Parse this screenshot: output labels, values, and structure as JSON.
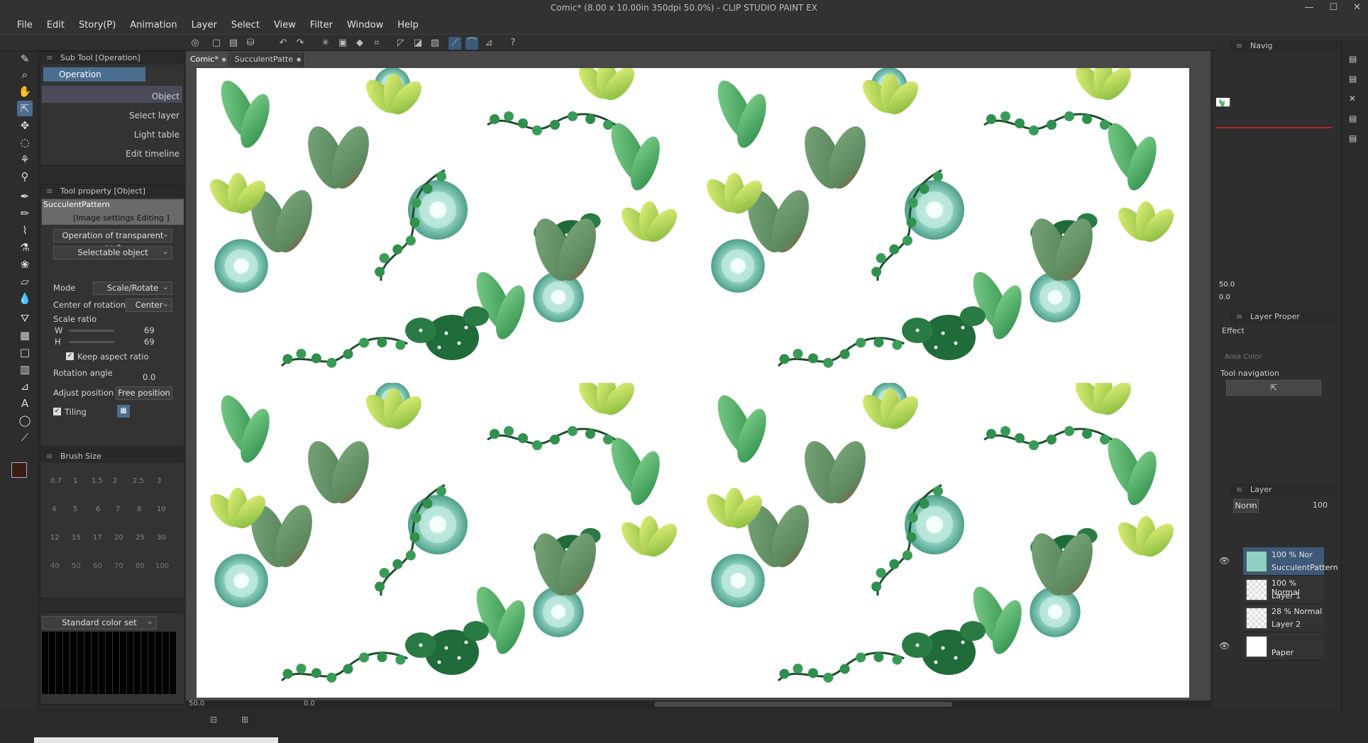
{
  "window": {
    "title": "Comic* (8.00 x 10.00in 350dpi 50.0%) - CLIP STUDIO PAINT EX"
  },
  "menu": [
    "File",
    "Edit",
    "Story(P)",
    "Animation",
    "Layer",
    "Select",
    "View",
    "Filter",
    "Window",
    "Help"
  ],
  "subtool_panel": {
    "title": "Sub Tool [Operation]",
    "group": "Operation",
    "items": [
      "Object",
      "Select layer",
      "Light table",
      "Edit timeline"
    ]
  },
  "tool_property": {
    "title": "Tool property [Object]",
    "layer_name": "SucculentPattern",
    "editing_label": "[Image settings Editing ]",
    "transparent_part": "Operation of transparent part",
    "selectable": "Selectable object",
    "mode_label": "Mode",
    "mode_value": "Scale/Rotate",
    "center_label": "Center of rotation",
    "center_value": "Center",
    "scale_label": "Scale ratio",
    "w_label": "W",
    "w_value": "69",
    "h_label": "H",
    "h_value": "69",
    "keep_aspect": "Keep aspect ratio",
    "rotation_label": "Rotation angle",
    "rotation_value": "0.0",
    "adjust_label": "Adjust position",
    "adjust_value": "Free position",
    "tiling_label": "Tiling"
  },
  "brush_size": {
    "title": "Brush Size",
    "sizes": [
      "0.7",
      "1",
      "1.5",
      "2",
      "2.5",
      "3",
      "4",
      "5",
      "6",
      "7",
      "8",
      "10",
      "12",
      "15",
      "17",
      "20",
      "25",
      "30",
      "40",
      "50",
      "60",
      "70",
      "80",
      "100"
    ]
  },
  "color_set": {
    "label": "Standard color set"
  },
  "documents": [
    {
      "label": "Comic*",
      "active": true
    },
    {
      "label": "SucculentPatte",
      "active": false
    }
  ],
  "navigator": {
    "title": "Navig",
    "zoom": "50.0",
    "angle": "0.0"
  },
  "layer_property": {
    "title": "Layer Proper",
    "effect": "Effect",
    "area_color": "Area Color",
    "tool_navigation": "Tool navigation"
  },
  "layers_panel": {
    "title": "Layer",
    "blend": "Norm",
    "opacity": "100",
    "layers": [
      {
        "blend": "100 % Nor",
        "name": "SucculentPattern",
        "selected": true
      },
      {
        "blend": "100 % Normal",
        "name": "Layer 1",
        "selected": false
      },
      {
        "blend": "28 % Normal",
        "name": "Layer 2",
        "selected": false
      },
      {
        "blend": "",
        "name": "Paper",
        "selected": false
      }
    ]
  },
  "canvas_status": {
    "zoom": "50.0",
    "angle": "0.0"
  },
  "colors": {
    "accent": "#4b6d8f",
    "selection": "#3f5a78",
    "succulent_dark": "#1e5a32",
    "succulent_mint": "#8fd1c0",
    "succulent_lime": "#b6d84a"
  }
}
